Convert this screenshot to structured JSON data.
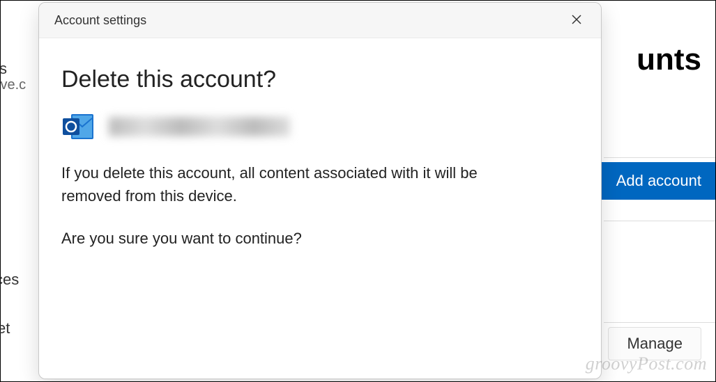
{
  "background": {
    "page_title_fragment": "unts",
    "sidebar_frag_1": "s",
    "sidebar_frag_2": "ive.c",
    "sidebar_frag_3": "ces",
    "sidebar_frag_4": "et",
    "add_account_label": "Add account",
    "manage_label": "Manage"
  },
  "modal": {
    "header_title": "Account settings",
    "heading": "Delete this account?",
    "warning_text": "If you delete this account, all content associated with it will be removed from this device.",
    "confirm_text": "Are you sure you want to continue?",
    "icon_name": "outlook-icon"
  },
  "watermark": "groovyPost.com"
}
